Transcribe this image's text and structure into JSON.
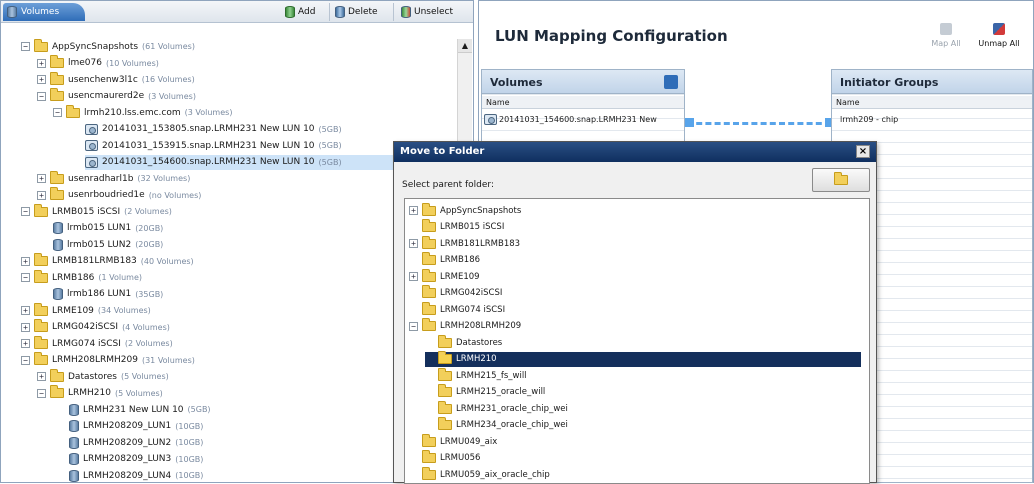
{
  "left": {
    "tab_label": "Volumes",
    "toolbar": {
      "add": "Add",
      "delete": "Delete",
      "unselect": "Unselect"
    },
    "tree": [
      {
        "indent": 0,
        "exp": "−",
        "icon": "folder",
        "label": "AppSyncSnapshots",
        "count": "(61 Volumes)"
      },
      {
        "indent": 1,
        "exp": "+",
        "icon": "folder",
        "label": "lme076",
        "count": "(10 Volumes)"
      },
      {
        "indent": 1,
        "exp": "+",
        "icon": "folder",
        "label": "usenchenw3l1c",
        "count": "(16 Volumes)"
      },
      {
        "indent": 1,
        "exp": "−",
        "icon": "folder",
        "label": "usencmaurerd2e",
        "count": "(3 Volumes)"
      },
      {
        "indent": 2,
        "exp": "−",
        "icon": "folder",
        "label": "lrmh210.lss.emc.com",
        "count": "(3 Volumes)"
      },
      {
        "indent": 4,
        "exp": "",
        "icon": "snap",
        "label": "20141031_153805.snap.LRMH231 New LUN 10",
        "count": "(5GB)"
      },
      {
        "indent": 4,
        "exp": "",
        "icon": "snap",
        "label": "20141031_153915.snap.LRMH231 New LUN 10",
        "count": "(5GB)"
      },
      {
        "indent": 4,
        "exp": "",
        "icon": "snap",
        "label": "20141031_154600.snap.LRMH231 New LUN 10",
        "count": "(5GB)",
        "selected": true
      },
      {
        "indent": 1,
        "exp": "+",
        "icon": "folder",
        "label": "usenradharl1b",
        "count": "(32 Volumes)"
      },
      {
        "indent": 1,
        "exp": "+",
        "icon": "folder",
        "label": "usenrboudried1e",
        "count": "(no Volumes)"
      },
      {
        "indent": 0,
        "exp": "−",
        "icon": "folder",
        "label": "LRMB015 iSCSI",
        "count": "(2 Volumes)"
      },
      {
        "indent": 2,
        "exp": "",
        "icon": "db",
        "label": "lrmb015 LUN1",
        "count": "(20GB)"
      },
      {
        "indent": 2,
        "exp": "",
        "icon": "db",
        "label": "lrmb015 LUN2",
        "count": "(20GB)"
      },
      {
        "indent": 0,
        "exp": "+",
        "icon": "folder",
        "label": "LRMB181LRMB183",
        "count": "(40 Volumes)"
      },
      {
        "indent": 0,
        "exp": "−",
        "icon": "folder",
        "label": "LRMB186",
        "count": "(1 Volume)"
      },
      {
        "indent": 2,
        "exp": "",
        "icon": "db",
        "label": "lrmb186 LUN1",
        "count": "(35GB)"
      },
      {
        "indent": 0,
        "exp": "+",
        "icon": "folder",
        "label": "LRME109",
        "count": "(34 Volumes)"
      },
      {
        "indent": 0,
        "exp": "+",
        "icon": "folder",
        "label": "LRMG042iSCSI",
        "count": "(4 Volumes)"
      },
      {
        "indent": 0,
        "exp": "+",
        "icon": "folder",
        "label": "LRMG074 iSCSI",
        "count": "(2 Volumes)"
      },
      {
        "indent": 0,
        "exp": "−",
        "icon": "folder",
        "label": "LRMH208LRMH209",
        "count": "(31 Volumes)"
      },
      {
        "indent": 1,
        "exp": "+",
        "icon": "folder",
        "label": "Datastores",
        "count": "(5 Volumes)"
      },
      {
        "indent": 1,
        "exp": "−",
        "icon": "folder",
        "label": "LRMH210",
        "count": "(5 Volumes)"
      },
      {
        "indent": 3,
        "exp": "",
        "icon": "db",
        "label": "LRMH231 New LUN 10",
        "count": "(5GB)"
      },
      {
        "indent": 3,
        "exp": "",
        "icon": "db",
        "label": "LRMH208209_LUN1",
        "count": "(10GB)"
      },
      {
        "indent": 3,
        "exp": "",
        "icon": "db",
        "label": "LRMH208209_LUN2",
        "count": "(10GB)"
      },
      {
        "indent": 3,
        "exp": "",
        "icon": "db",
        "label": "LRMH208209_LUN3",
        "count": "(10GB)"
      },
      {
        "indent": 3,
        "exp": "",
        "icon": "db",
        "label": "LRMH208209_LUN4",
        "count": "(10GB)"
      }
    ]
  },
  "right": {
    "title": "LUN Mapping Configuration",
    "map_all": "Map All",
    "unmap_all": "Unmap All",
    "volumes": {
      "header": "Volumes",
      "col": "Name",
      "row": "20141031_154600.snap.LRMH231 New"
    },
    "initiators": {
      "header": "Initiator Groups",
      "col": "Name",
      "row": "lrmh209 - chip"
    }
  },
  "dialog": {
    "title": "Move to Folder",
    "close": "×",
    "label": "Select parent folder:",
    "tree": [
      {
        "indent": 0,
        "exp": "+",
        "label": "AppSyncSnapshots"
      },
      {
        "indent": 0,
        "exp": "",
        "label": "LRMB015 iSCSI"
      },
      {
        "indent": 0,
        "exp": "+",
        "label": "LRMB181LRMB183"
      },
      {
        "indent": 0,
        "exp": "",
        "label": "LRMB186"
      },
      {
        "indent": 0,
        "exp": "+",
        "label": "LRME109"
      },
      {
        "indent": 0,
        "exp": "",
        "label": "LRMG042iSCSI"
      },
      {
        "indent": 0,
        "exp": "",
        "label": "LRMG074 iSCSI"
      },
      {
        "indent": 0,
        "exp": "−",
        "label": "LRMH208LRMH209"
      },
      {
        "indent": 1,
        "exp": "",
        "label": "Datastores"
      },
      {
        "indent": 1,
        "exp": "",
        "label": "LRMH210",
        "selected": true
      },
      {
        "indent": 1,
        "exp": "",
        "label": "LRMH215_fs_will"
      },
      {
        "indent": 1,
        "exp": "",
        "label": "LRMH215_oracle_will"
      },
      {
        "indent": 1,
        "exp": "",
        "label": "LRMH231_oracle_chip_wei"
      },
      {
        "indent": 1,
        "exp": "",
        "label": "LRMH234_oracle_chip_wei"
      },
      {
        "indent": 0,
        "exp": "",
        "label": "LRMU049_aix"
      },
      {
        "indent": 0,
        "exp": "",
        "label": "LRMU056"
      },
      {
        "indent": 0,
        "exp": "",
        "label": "LRMU059_aix_oracle_chip"
      }
    ]
  }
}
